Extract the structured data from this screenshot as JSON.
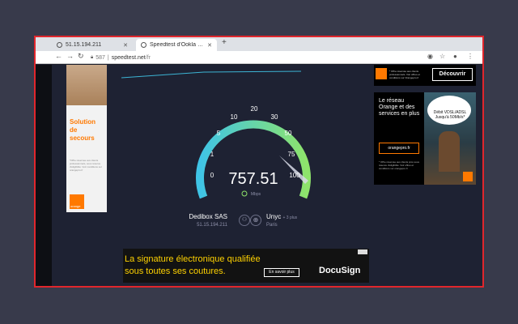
{
  "browser": {
    "tabs": [
      {
        "title": "51.15.194.211"
      },
      {
        "title": "Speedtest d'Ookla – le test"
      }
    ],
    "address": {
      "port": "587",
      "domain": "speedtest.net",
      "path": "/fr"
    }
  },
  "speedtest": {
    "scale": [
      "0",
      "1",
      "5",
      "10",
      "20",
      "30",
      "50",
      "75",
      "100"
    ],
    "reading": "757.51",
    "unit": "Mbps",
    "server": {
      "name": "Dedibox SAS",
      "ip": "51.15.194.211"
    },
    "host": {
      "name": "Unyc",
      "more": "+ 3 plus",
      "city": "Paris"
    }
  },
  "ads": {
    "left": {
      "headline": "Solution de secours",
      "fine": "*Offre réservée aux clients professionnels, sous réserve d'éligibilité. Voir conditions sur orangepro.fr",
      "logo": "orange"
    },
    "top_right": {
      "fine": "* Offre réservée aux clients professionnels. Voir offres et conditions sur Orangepro.fr",
      "button": "Découvrir"
    },
    "right": {
      "headline": "Le réseau Orange et des services en plus",
      "bubble": "Débit VDSL/ADSL Jusqu'à 50Mb/s*",
      "cta": "orangepro.fr",
      "fine": "* Offre réservée aux clients pros sous réserve d'éligibilité. Voir offres et conditions sur orangepro.fr"
    },
    "bottom": {
      "line1": "La signature électronique qualifiée",
      "line2": "sous toutes ses coutures.",
      "button": "En savoir plus",
      "brand": "DocuSign"
    }
  },
  "colors": {
    "accent": "#e0262c",
    "orange": "#ff7900",
    "gauge_start": "#3fc4e6",
    "gauge_end": "#8ee46b"
  }
}
